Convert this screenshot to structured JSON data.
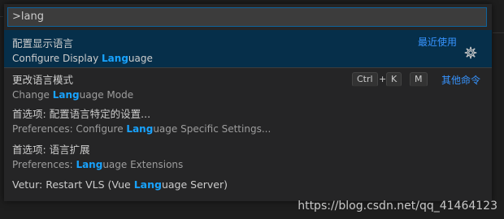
{
  "input": {
    "value": ">lang"
  },
  "items": [
    {
      "cn": "配置显示语言",
      "en_pre": "Configure Display ",
      "en_hl": "Lang",
      "en_post": "uage",
      "recent": "最近使用"
    },
    {
      "cn": "更改语言模式",
      "en_pre": "Change ",
      "en_hl": "Lang",
      "en_post": "uage Mode",
      "key1": "Ctrl",
      "plus": "+",
      "key2": "K",
      "key3": "M",
      "other": "其他命令"
    },
    {
      "cn": "首选项: 配置语言特定的设置...",
      "en_pre": "Preferences: Configure ",
      "en_hl": "Lang",
      "en_post": "uage Specific Settings..."
    },
    {
      "cn": "首选项: 语言扩展",
      "en_pre": "Preferences: ",
      "en_hl": "Lang",
      "en_post": "uage Extensions"
    },
    {
      "en_pre": "Vetur: Restart VLS (Vue ",
      "en_hl": "Lang",
      "en_post": "uage Server)"
    }
  ],
  "watermark": "https://blog.csdn.net/qq_41464123",
  "icons": {
    "gear": "gear-icon"
  },
  "colors": {
    "accent": "#3794ff",
    "highlight": "#18a3ff",
    "selected": "#062f4a"
  }
}
